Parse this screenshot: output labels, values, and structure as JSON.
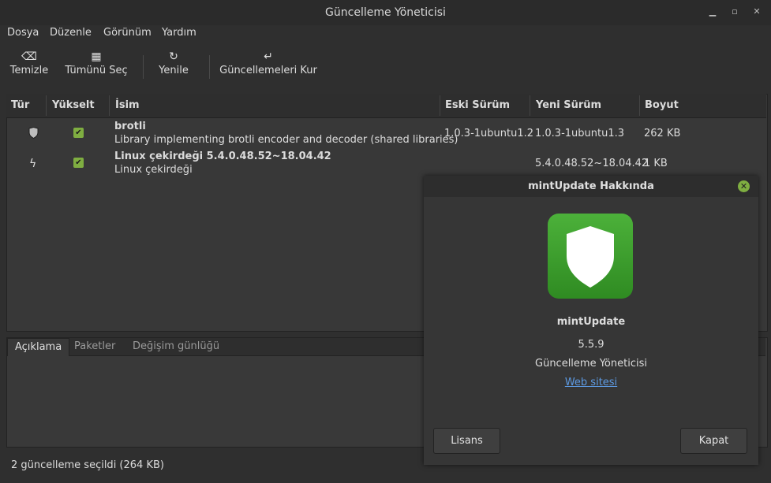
{
  "window": {
    "title": "Güncelleme Yöneticisi"
  },
  "menu": [
    "Dosya",
    "Düzenle",
    "Görünüm",
    "Yardım"
  ],
  "toolbar": {
    "clear": "Temizle",
    "select_all": "Tümünü Seç",
    "refresh": "Yenile",
    "install": "Güncellemeleri Kur"
  },
  "table": {
    "headers": [
      "Tür",
      "Yükselt",
      "İsim",
      "Eski Sürüm",
      "Yeni Sürüm",
      "Boyut"
    ],
    "rows": [
      {
        "type_icon": "shield-icon",
        "checked": true,
        "name": "brotli",
        "desc": "Library implementing brotli encoder and decoder (shared libraries)",
        "old": "1.0.3-1ubuntu1.2",
        "new": "1.0.3-1ubuntu1.3",
        "size": "262 KB"
      },
      {
        "type_icon": "lightning-icon",
        "checked": true,
        "name": "Linux çekirdeği 5.4.0.48.52~18.04.42",
        "desc": "Linux çekirdeği",
        "old": "",
        "new": "5.4.0.48.52~18.04.42",
        "size": "1 KB"
      }
    ]
  },
  "tabs": [
    "Açıklama",
    "Paketler",
    "Değişim günlüğü"
  ],
  "status": "2 güncelleme seçildi (264 KB)",
  "dialog": {
    "title": "mintUpdate Hakkında",
    "app_name": "mintUpdate",
    "version": "5.5.9",
    "subtitle": "Güncelleme Yöneticisi",
    "website": "Web sitesi",
    "license_btn": "Lisans",
    "close_btn": "Kapat"
  },
  "colors": {
    "accent": "#7fae41",
    "logo": "#3fa330"
  }
}
